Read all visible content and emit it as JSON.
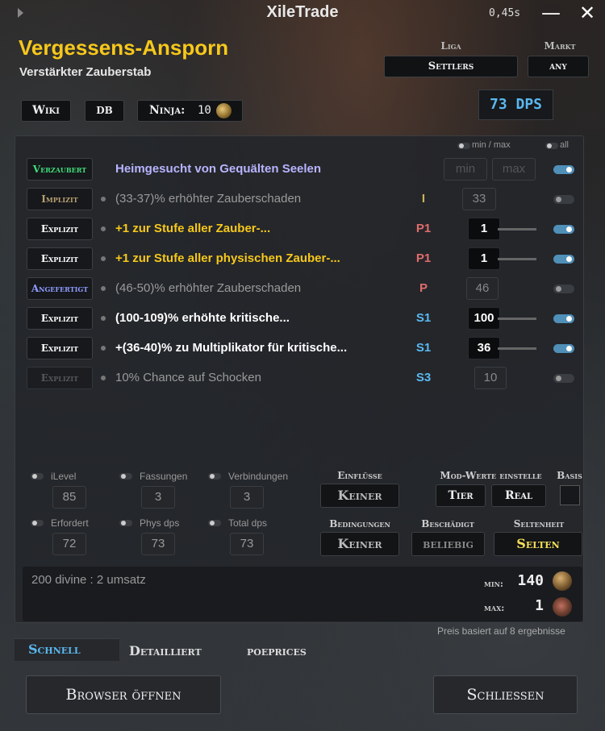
{
  "window": {
    "title": "XileTrade",
    "timer": "0,45s",
    "minimize": "—",
    "close": "✕"
  },
  "item": {
    "name": "Vergessens-Ansporn",
    "base": "Verstärkter Zauberstab"
  },
  "league": {
    "label": "Liga",
    "value": "Settlers"
  },
  "market": {
    "label": "Markt",
    "value": "any"
  },
  "links": {
    "wiki": "Wiki",
    "db": "DB",
    "ninja_label": "Ninja:",
    "ninja_value": "10"
  },
  "dps": "73 DPS",
  "filter_header": {
    "minmax": "min / max",
    "all": "all"
  },
  "mods": [
    {
      "type": "Verzaubert",
      "type_color": "#3fdc7a",
      "text": "Heimgesucht von Gequälten Seelen",
      "text_color": "#b8b4ff",
      "tier": "",
      "value": "",
      "min_placeholder": "min",
      "max_placeholder": "max",
      "enabled": true
    },
    {
      "type": "Implizit",
      "type_color": "#b7a070",
      "text": "(33-37)% erhöhter Zauberschaden",
      "text_color": "#9a9a9a",
      "tier": "I",
      "tier_color": "#c9b35b",
      "value": "33",
      "enabled": false
    },
    {
      "type": "Explizit",
      "type_color": "#ffffff",
      "text": "+1 zur Stufe aller Zauber-...",
      "text_color": "#f6c81b",
      "tier": "P1",
      "tier_color": "#e06c6c",
      "value": "1",
      "enabled": true
    },
    {
      "type": "Explizit",
      "type_color": "#ffffff",
      "text": "+1 zur Stufe aller physischen Zauber-...",
      "text_color": "#f6c81b",
      "tier": "P1",
      "tier_color": "#e06c6c",
      "value": "1",
      "enabled": true
    },
    {
      "type": "Angefertigt",
      "type_color": "#8f9bff",
      "text": "(46-50)% erhöhter Zauberschaden",
      "text_color": "#9a9a9a",
      "tier": "P",
      "tier_color": "#e06c6c",
      "value": "46",
      "enabled": false
    },
    {
      "type": "Explizit",
      "type_color": "#ffffff",
      "text": "(100-109)% erhöhte kritische...",
      "text_color": "#ffffff",
      "tier": "S1",
      "tier_color": "#5ab8f0",
      "value": "100",
      "enabled": true
    },
    {
      "type": "Explizit",
      "type_color": "#ffffff",
      "text": "+(36-40)% zu Multiplikator für kritische...",
      "text_color": "#ffffff",
      "tier": "S1",
      "tier_color": "#5ab8f0",
      "value": "36",
      "enabled": true
    },
    {
      "type": "Explizit",
      "type_color": "#777777",
      "text": "10% Chance auf Schocken",
      "text_color": "#9a9a9a",
      "tier": "S3",
      "tier_color": "#5ab8f0",
      "value": "10",
      "enabled": false
    }
  ],
  "stats": [
    {
      "label": "iLevel",
      "value": "85"
    },
    {
      "label": "Fassungen",
      "value": "3"
    },
    {
      "label": "Verbindungen",
      "value": "3"
    },
    {
      "label": "Erfordert",
      "value": "72"
    },
    {
      "label": "Phys dps",
      "value": "73"
    },
    {
      "label": "Total dps",
      "value": "73"
    }
  ],
  "influences": {
    "label": "Einflüsse",
    "value": "Keiner"
  },
  "mod_values": {
    "label": "Mod-Werte einstelle",
    "tier": "Tier",
    "real": "Real"
  },
  "basis": {
    "label": "Basis"
  },
  "conditions": {
    "label": "Bedingungen",
    "value": "Keiner"
  },
  "corrupted": {
    "label": "Beschädigt",
    "value": "beliebig"
  },
  "rarity": {
    "label": "Seltenheit",
    "value": "Selten"
  },
  "price": {
    "summary": "200 divine : 2 umsatz",
    "min_label": "min:",
    "min_value": "140",
    "max_label": "max:",
    "max_value": "1",
    "note": "Preis basiert auf 8 ergebnisse"
  },
  "tabs": [
    "Schnell",
    "Detailliert",
    "poeprices"
  ],
  "footer": {
    "open_browser": "Browser öffnen",
    "close": "Schliessen"
  },
  "colors": {
    "accent_blue": "#5ab8f0",
    "unique_gold": "#f6c81b",
    "rare_gold": "#f6e05a"
  }
}
